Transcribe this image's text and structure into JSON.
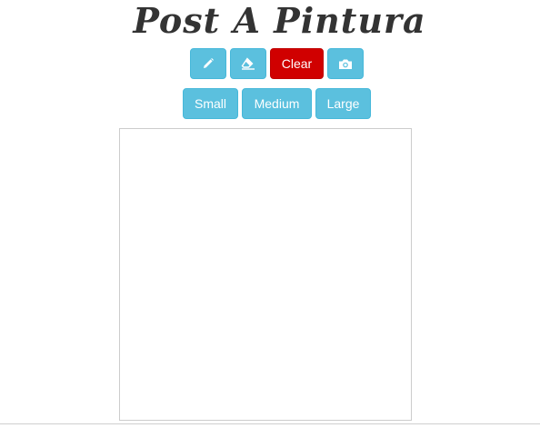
{
  "app": {
    "title": "Post A Pintura"
  },
  "toolbar": {
    "pencil": {
      "icon": "pencil-icon"
    },
    "eraser": {
      "icon": "eraser-icon"
    },
    "clear_label": "Clear",
    "camera": {
      "icon": "camera-icon"
    }
  },
  "sizes": {
    "small_label": "Small",
    "medium_label": "Medium",
    "large_label": "Large"
  },
  "colors": {
    "info_button": "#5bc0de",
    "danger_button": "#d00000",
    "title_text": "#333333"
  }
}
